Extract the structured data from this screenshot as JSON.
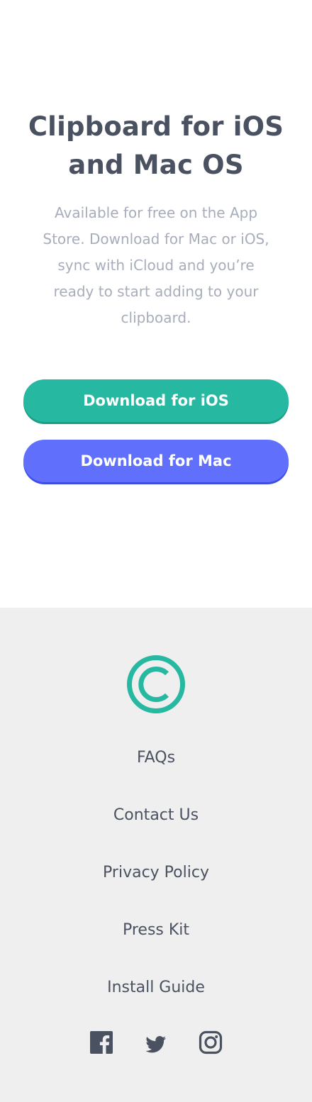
{
  "cta": {
    "title_line1": "Clipboard for iOS",
    "title_line2": "and Mac OS",
    "description_lines": [
      "Available for free on the App",
      "Store. Download for Mac or iOS,",
      "sync with iCloud and you’re",
      "ready to start adding to your",
      "clipboard."
    ],
    "ios_button_label": "Download for iOS",
    "mac_button_label": "Download for Mac"
  },
  "footer": {
    "links": [
      {
        "label": "FAQs"
      },
      {
        "label": "Contact Us"
      },
      {
        "label": "Privacy Policy"
      },
      {
        "label": "Press Kit"
      },
      {
        "label": "Install Guide"
      }
    ],
    "social_icons": [
      "facebook-icon",
      "twitter-icon",
      "instagram-icon"
    ]
  },
  "colors": {
    "accent_green": "#26b8a0",
    "accent_blue": "#6070fd",
    "heading": "#4a5160",
    "body_text": "#a7adbb",
    "footer_bg": "#efefef"
  }
}
